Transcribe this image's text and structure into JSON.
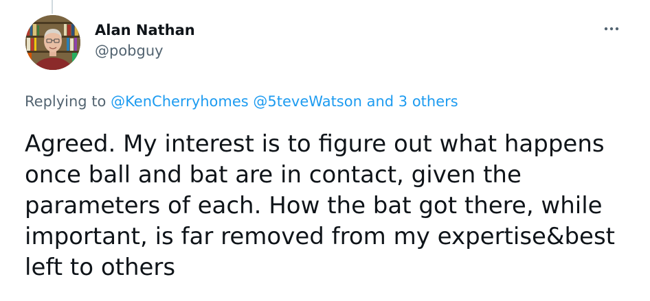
{
  "author": {
    "display_name": "Alan Nathan",
    "handle": "@pobguy"
  },
  "more_icon": "more-dots-icon",
  "reply_context": {
    "prefix": "Replying to ",
    "mention_1": "@KenCherryhomes",
    "mention_2": "@5teveWatson",
    "others": "and 3 others"
  },
  "tweet": {
    "text": "Agreed. My interest is to figure out what happens\nonce ball and bat are in contact, given the\nparameters of each.  How the bat got there, while\nimportant, is far removed from my expertise&best\nleft to others"
  },
  "colors": {
    "link": "#1d9bf0",
    "secondary_text": "#536471",
    "primary_text": "#0f1419"
  }
}
